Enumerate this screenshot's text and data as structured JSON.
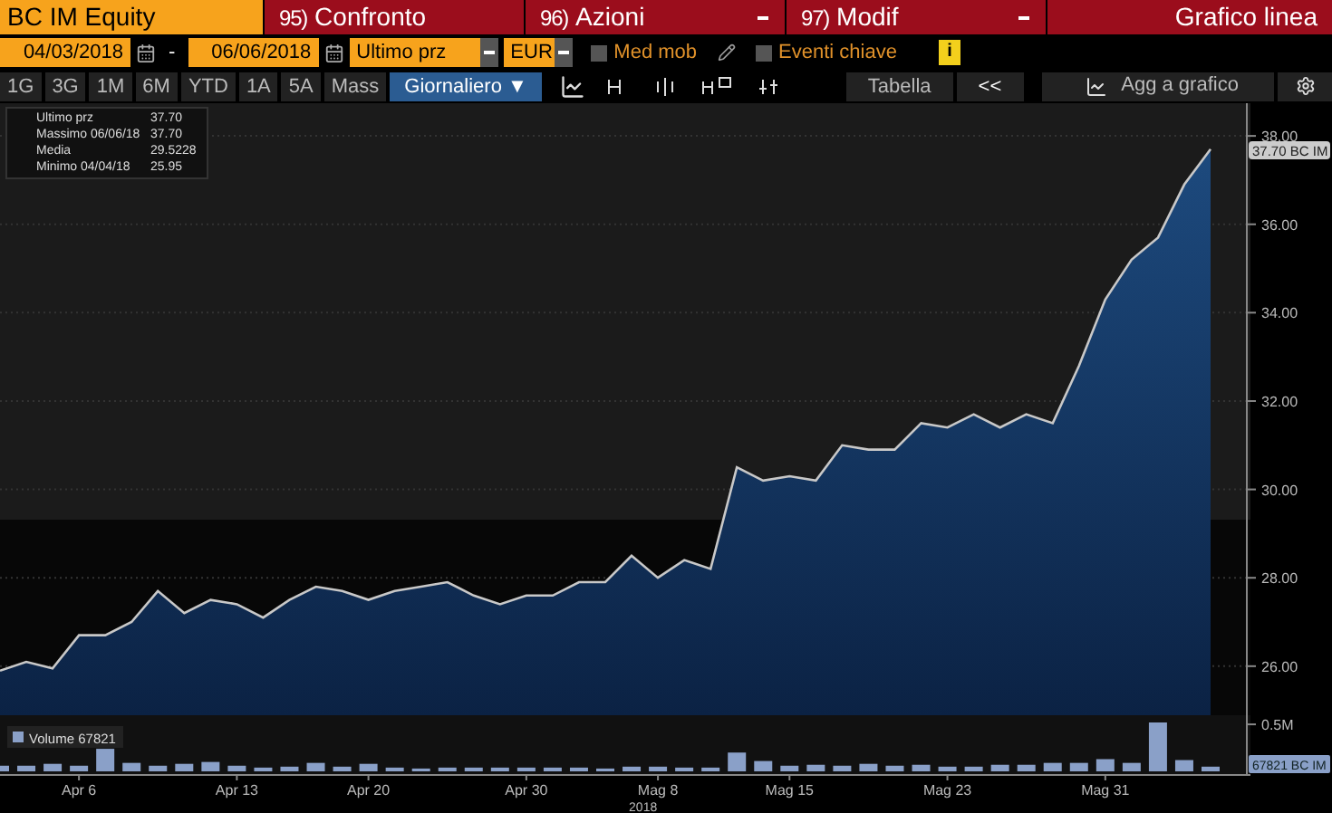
{
  "title_bar": {
    "security": "BC IM Equity",
    "actions": [
      {
        "number": "95)",
        "label": "Confronto",
        "dropdown": false
      },
      {
        "number": "96)",
        "label": "Azioni",
        "dropdown": true
      },
      {
        "number": "97)",
        "label": "Modif",
        "dropdown": true
      }
    ],
    "view_title": "Grafico linea"
  },
  "settings_bar": {
    "start_date": "04/03/2018",
    "separator": "-",
    "end_date": "06/06/2018",
    "field": "Ultimo prz",
    "currency": "EUR",
    "moving_average": {
      "label": "Med mob",
      "checked": false
    },
    "key_events": {
      "label": "Eventi chiave",
      "checked": false
    },
    "info": "i"
  },
  "toolbar": {
    "ranges": [
      {
        "label": "1G",
        "selected": false
      },
      {
        "label": "3G",
        "selected": false
      },
      {
        "label": "1M",
        "selected": false
      },
      {
        "label": "6M",
        "selected": false
      },
      {
        "label": "YTD",
        "selected": false
      },
      {
        "label": "1A",
        "selected": false
      },
      {
        "label": "5A",
        "selected": false
      },
      {
        "label": "Mass",
        "selected": false
      }
    ],
    "frequency": "Giornaliero ▼",
    "table": "Tabella",
    "collapse": "<<",
    "add": "Agg a grafico"
  },
  "legend": [
    {
      "value": "37.70"
    },
    {
      "label": "Massimo 06/06/18",
      "value": "37.70"
    },
    {
      "label": "Media",
      "value": "29.5228"
    },
    {
      "label": "Minimo 04/04/18",
      "value": "25.95"
    }
  ],
  "price_tag": "37.70 BC IM",
  "price_chart": {
    "chart_data": {
      "type": "area",
      "grid": true,
      "series": [
        {
          "name": "Ultimo prz",
          "color": "#c8c8c8",
          "values": [
            25.9,
            26.1,
            25.95,
            26.7,
            26.7,
            27.0,
            27.7,
            27.2,
            27.5,
            27.4,
            27.1,
            27.5,
            27.8,
            27.7,
            27.5,
            27.7,
            27.8,
            27.9,
            27.6,
            27.4,
            27.6,
            27.6,
            27.9,
            27.9,
            28.5,
            28.0,
            28.4,
            28.2,
            30.5,
            30.2,
            30.3,
            30.2,
            31.0,
            30.9,
            30.9,
            31.5,
            31.4,
            31.7,
            31.4,
            31.7,
            31.5,
            32.8,
            34.3,
            35.2,
            35.7,
            36.9,
            37.7
          ]
        }
      ],
      "ylim": [
        24.89,
        38.74
      ],
      "yticks": [
        {
          "value": 26,
          "label": "26.00"
        },
        {
          "value": 28,
          "label": "28.00"
        },
        {
          "value": 30,
          "label": "30.00"
        },
        {
          "value": 32,
          "label": "32.00"
        },
        {
          "value": 34,
          "label": "34.00"
        },
        {
          "value": 36,
          "label": "36.00"
        },
        {
          "value": 38,
          "label": "38.00"
        }
      ]
    }
  },
  "volume_value": "67821",
  "volume_tag": "67821 BC IM",
  "volume_chart": {
    "chart_data": {
      "type": "bar",
      "categories": [
        null,
        null,
        null,
        "Apr 6",
        null,
        null,
        null,
        null,
        null,
        "Apr 13",
        null,
        null,
        null,
        null,
        "Apr 20",
        null,
        null,
        null,
        null,
        null,
        "Apr 30",
        null,
        null,
        null,
        null,
        "Mag 8",
        null,
        null,
        null,
        null,
        "Mag 15",
        null,
        null,
        null,
        null,
        null,
        "Mag 23",
        null,
        null,
        null,
        null,
        null,
        "Mag 31",
        null,
        null,
        null,
        null
      ],
      "series": [
        {
          "name": "Volume",
          "color": "#8aa0c8",
          "values": [
            60000,
            60000,
            80000,
            60000,
            240000,
            90000,
            60000,
            80000,
            100000,
            60000,
            40000,
            50000,
            90000,
            50000,
            80000,
            40000,
            30000,
            40000,
            40000,
            40000,
            40000,
            40000,
            40000,
            30000,
            50000,
            50000,
            40000,
            40000,
            200000,
            110000,
            60000,
            70000,
            60000,
            80000,
            60000,
            70000,
            50000,
            50000,
            70000,
            70000,
            90000,
            90000,
            130000,
            90000,
            520000,
            120000,
            50000
          ]
        }
      ],
      "ylim": [
        0,
        520000
      ],
      "yticks": [
        {
          "value": 500000,
          "label": "0.5M"
        }
      ],
      "xlabel": "2018"
    }
  }
}
